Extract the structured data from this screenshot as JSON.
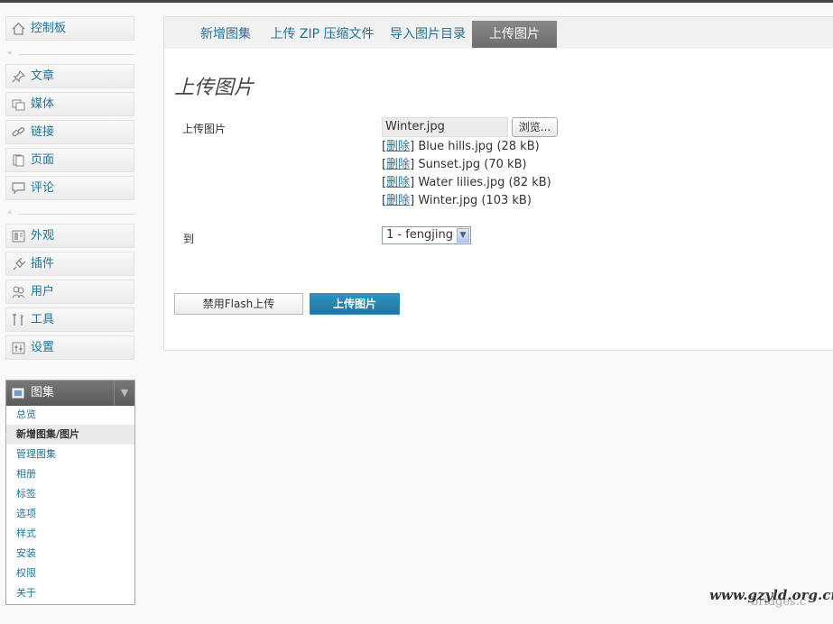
{
  "sidebar": {
    "dashboard": {
      "label": "控制板",
      "icon": "home-icon"
    },
    "group1": [
      {
        "label": "文章",
        "icon": "pushpin-icon"
      },
      {
        "label": "媒体",
        "icon": "media-icon"
      },
      {
        "label": "链接",
        "icon": "link-icon"
      },
      {
        "label": "页面",
        "icon": "pages-icon"
      },
      {
        "label": "评论",
        "icon": "comment-icon"
      }
    ],
    "group2": [
      {
        "label": "外观",
        "icon": "appearance-icon"
      },
      {
        "label": "插件",
        "icon": "plugin-icon"
      },
      {
        "label": "用户",
        "icon": "users-icon"
      },
      {
        "label": "工具",
        "icon": "tools-icon"
      },
      {
        "label": "设置",
        "icon": "settings-icon"
      }
    ],
    "gallery": {
      "label": "图集",
      "items": [
        "总览",
        "新增图集/图片",
        "管理图集",
        "相册",
        "标签",
        "选项",
        "样式",
        "安装",
        "权限",
        "关于"
      ],
      "current_index": 1
    }
  },
  "tabs": [
    "新增图集",
    "上传  ZIP 压缩文件",
    "导入图片目录",
    "上传图片"
  ],
  "active_tab": 3,
  "form": {
    "title": "上传图片",
    "upload_label": "上传图片",
    "file_value": "Winter.jpg",
    "browse_label": "浏览...",
    "delete_label": "删除",
    "files": [
      "Blue hills.jpg (28 kB)",
      "Sunset.jpg (70 kB)",
      "Water lilies.jpg (82 kB)",
      "Winter.jpg (103 kB)"
    ],
    "to_label": "到",
    "gallery_select": "1 - fengjing",
    "disable_flash_button": "禁用Flash上传",
    "upload_button": "上传图片"
  },
  "watermark": "www.gzyld.org.cn",
  "watermark_faint": "bridges.c"
}
